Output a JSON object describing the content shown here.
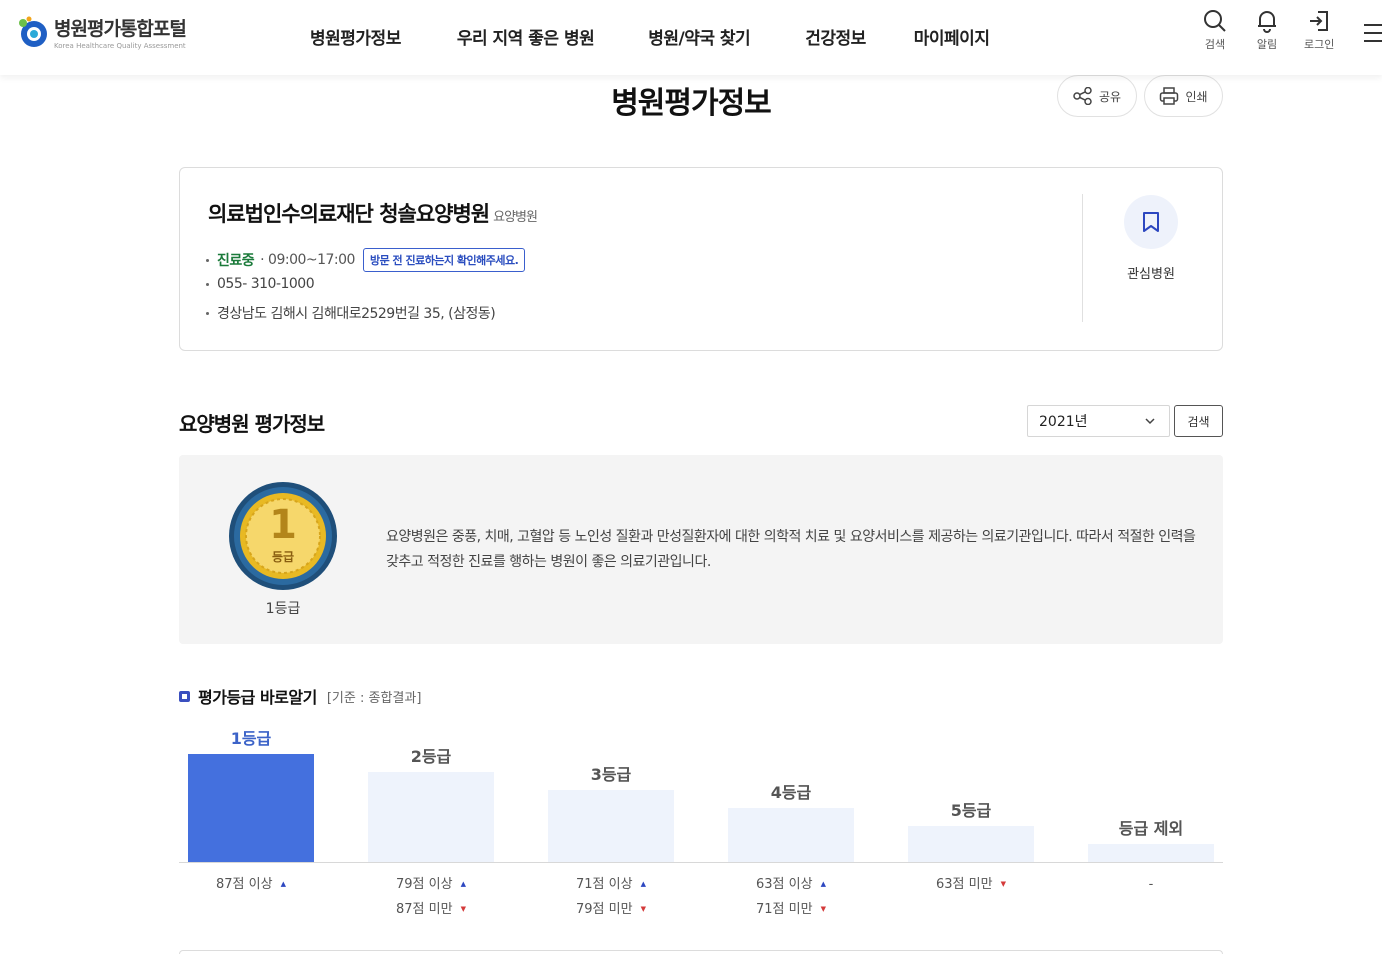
{
  "header": {
    "logo_title": "병원평가통합포털",
    "logo_sub": "Korea Healthcare Quality Assessment",
    "nav": [
      "병원평가정보",
      "우리 지역 좋은 병원",
      "병원/약국 찾기",
      "건강정보",
      "마이페이지"
    ],
    "util": {
      "search": "검색",
      "notify": "알림",
      "login": "로그인"
    }
  },
  "page": {
    "title": "병원평가정보",
    "share": "공유",
    "print": "인쇄"
  },
  "hospital": {
    "name": "의료법인수의료재단 청솔요양병원",
    "type": "요양병원",
    "status": "진료중",
    "hours": "· 09:00~17:00",
    "notice": "방문 전 진료하는지 확인해주세요.",
    "phone": "055- 310-1000",
    "address": "경상남도 김해시 김해대로2529번길 35, (삼정동)",
    "bookmark_label": "관심병원"
  },
  "evaluation": {
    "section_title": "요양병원 평가정보",
    "year": "2021년",
    "search_label": "검색",
    "medal_grade": "1",
    "medal_text": "등급",
    "grade_label": "1등급",
    "description": "요양병원은 중풍, 치매, 고혈압 등 노인성 질환과 만성질환자에 대한 의학적 치료 및 요양서비스를 제공하는 의료기관입니다. 따라서 적절한 인력을 갖추고 적정한 진료를 행하는 병원이 좋은 의료기관입니다."
  },
  "grade_chart": {
    "title": "평가등급 바로알기",
    "basis": "[기준 : 종합결과]",
    "colors": {
      "active": "#4470de",
      "inactive": "#eef3fc",
      "active_label": "#3c63c8"
    },
    "grades": [
      {
        "label": "1등급",
        "active": true,
        "line1": "87점 이상",
        "dir1": "up",
        "line2": "",
        "dir2": ""
      },
      {
        "label": "2등급",
        "active": false,
        "line1": "79점 이상",
        "dir1": "up",
        "line2": "87점 미만",
        "dir2": "down"
      },
      {
        "label": "3등급",
        "active": false,
        "line1": "71점 이상",
        "dir1": "up",
        "line2": "79점 미만",
        "dir2": "down"
      },
      {
        "label": "4등급",
        "active": false,
        "line1": "63점 이상",
        "dir1": "up",
        "line2": "71점 미만",
        "dir2": "down"
      },
      {
        "label": "5등급",
        "active": false,
        "line1": "63점 미만",
        "dir1": "down",
        "line2": "",
        "dir2": ""
      },
      {
        "label": "등급 제외",
        "active": false,
        "line1": "-",
        "dir1": "",
        "line2": "",
        "dir2": ""
      }
    ]
  }
}
